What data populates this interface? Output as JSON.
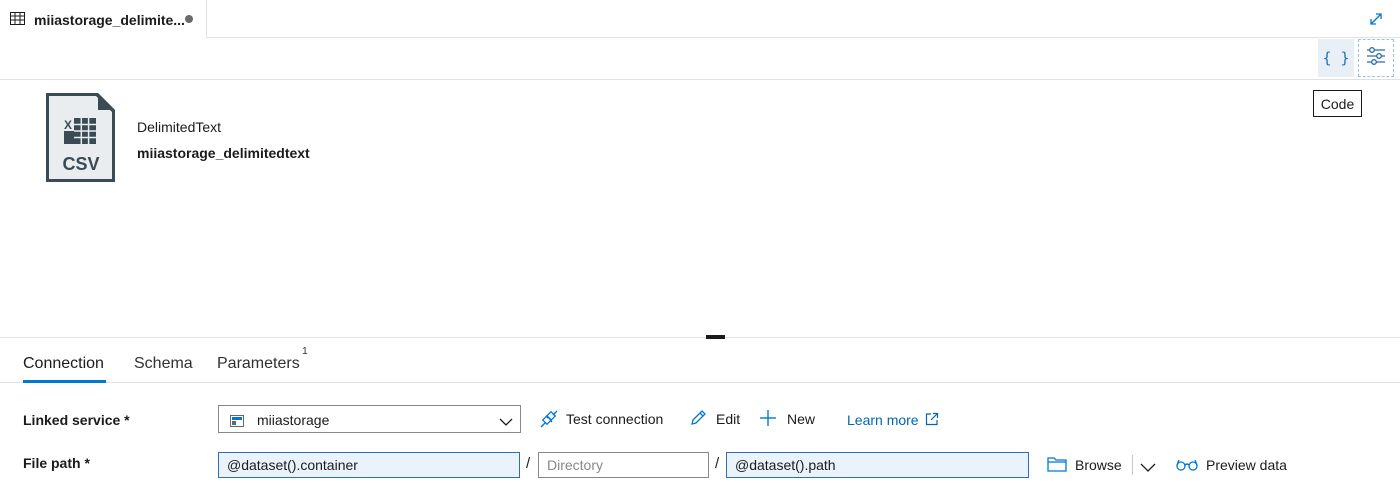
{
  "window": {
    "tab_title": "miiastorage_delimite...",
    "tab_icon": "table-icon",
    "unsaved": true,
    "expand_icon": "expand-icon"
  },
  "toolbar": {
    "code_icon_glyph": "{ }",
    "properties_icon": "sliders-icon",
    "tooltip": "Code"
  },
  "dataset": {
    "icon": "csv-file-icon",
    "icon_label": "CSV",
    "type": "DelimitedText",
    "name": "miiastorage_delimitedtext"
  },
  "tabs": [
    {
      "label": "Connection",
      "active": true
    },
    {
      "label": "Schema",
      "active": false
    },
    {
      "label": "Parameters",
      "active": false,
      "badge": "1"
    }
  ],
  "form": {
    "linked_service": {
      "label": "Linked service *",
      "value": "miiastorage",
      "test_connection": "Test connection",
      "edit": "Edit",
      "new": "New",
      "learn_more": "Learn more"
    },
    "file_path": {
      "label": "File path *",
      "container": "@dataset().container",
      "directory_placeholder": "Directory",
      "separator": "/",
      "file": "@dataset().path",
      "browse": "Browse",
      "preview": "Preview data"
    }
  },
  "colors": {
    "accent": "#0078d4",
    "link": "#0066b8",
    "expression_bg": "#eaf3fc"
  }
}
